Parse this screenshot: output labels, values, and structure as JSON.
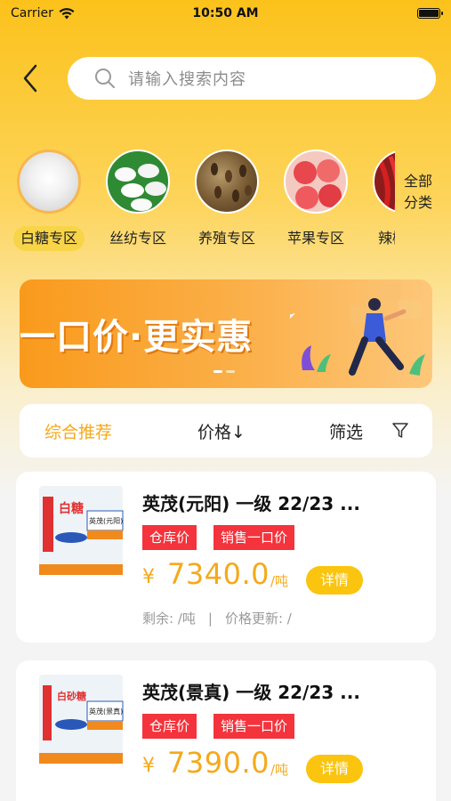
{
  "status": {
    "carrier": "Carrier",
    "time": "10:50 AM"
  },
  "search": {
    "placeholder": "请输入搜索内容"
  },
  "categories": [
    {
      "label": "白糖专区",
      "active": true
    },
    {
      "label": "丝纺专区",
      "active": false
    },
    {
      "label": "养殖专区",
      "active": false
    },
    {
      "label": "苹果专区",
      "active": false
    },
    {
      "label": "辣椒专区",
      "active": false
    }
  ],
  "all_categories": {
    "line1": "全部",
    "line2": "分类"
  },
  "banner": {
    "text": "一口价·更实惠"
  },
  "sort": {
    "recommend": "综合推荐",
    "price": "价格↓",
    "filter": "筛选"
  },
  "products": [
    {
      "title": "英茂(元阳) 一级 22/23 ...",
      "tag_warehouse": "仓库价",
      "tag_fixed": "销售一口价",
      "currency": "¥",
      "price": "7340.0",
      "unit": "/吨",
      "detail": "详情",
      "remaining": "剩余: /吨",
      "sep": "|",
      "updated": "价格更新: /",
      "package_text": "白糖",
      "package_label": "英茂(元阳)"
    },
    {
      "title": "英茂(景真) 一级 22/23 ...",
      "tag_warehouse": "仓库价",
      "tag_fixed": "销售一口价",
      "currency": "¥",
      "price": "7390.0",
      "unit": "/吨",
      "detail": "详情",
      "package_text": "白砂糖",
      "package_label": "英茂(景真)"
    }
  ],
  "colors": {
    "accent": "#f5a91a",
    "tag": "#f4333c",
    "brand_yellow": "#fcc21b"
  }
}
